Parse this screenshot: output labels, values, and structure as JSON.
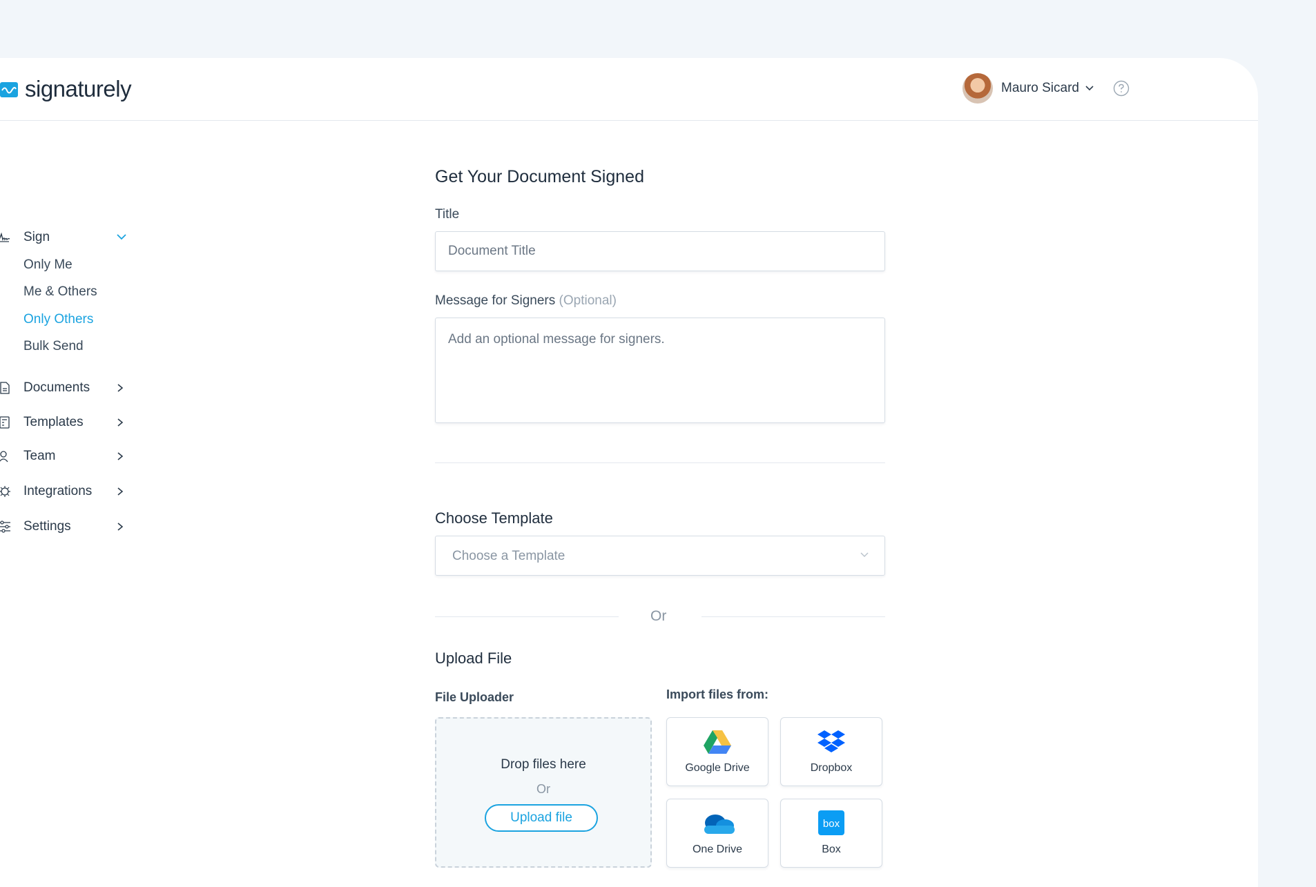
{
  "brand": {
    "name": "signaturely",
    "color": "#1aa3e0"
  },
  "user": {
    "name": "Mauro Sicard",
    "avatar_icon": "avatar",
    "dropdown_icon": "chevron-down-icon",
    "help_icon": "help-circle-icon"
  },
  "sidebar": {
    "sign": {
      "label": "Sign",
      "icon": "signature-icon",
      "items": [
        {
          "label": "Only Me"
        },
        {
          "label": "Me & Others"
        },
        {
          "label": "Only Others",
          "active": true
        },
        {
          "label": "Bulk Send"
        }
      ]
    },
    "sections": [
      {
        "label": "Documents",
        "icon": "document-icon"
      },
      {
        "label": "Templates",
        "icon": "template-icon"
      },
      {
        "label": "Team",
        "icon": "team-icon"
      },
      {
        "label": "Integrations",
        "icon": "integrations-icon"
      },
      {
        "label": "Settings",
        "icon": "settings-sliders-icon"
      }
    ]
  },
  "form": {
    "heading": "Get Your Document Signed",
    "title_label": "Title",
    "title_placeholder": "Document Title",
    "message_label": "Message for Signers",
    "message_optional": "(Optional)",
    "message_placeholder": "Add an optional message for signers.",
    "template_heading": "Choose Template",
    "template_placeholder": "Choose a Template",
    "or_label": "Or",
    "upload_heading": "Upload File",
    "uploader_label": "File Uploader",
    "drop_text": "Drop files here",
    "drop_or": "Or",
    "upload_button": "Upload file",
    "import_label": "Import files from:",
    "import_sources": [
      {
        "label": "Google Drive",
        "icon": "google-drive-icon"
      },
      {
        "label": "Dropbox",
        "icon": "dropbox-icon"
      },
      {
        "label": "One Drive",
        "icon": "onedrive-icon"
      },
      {
        "label": "Box",
        "icon": "box-icon"
      }
    ]
  }
}
